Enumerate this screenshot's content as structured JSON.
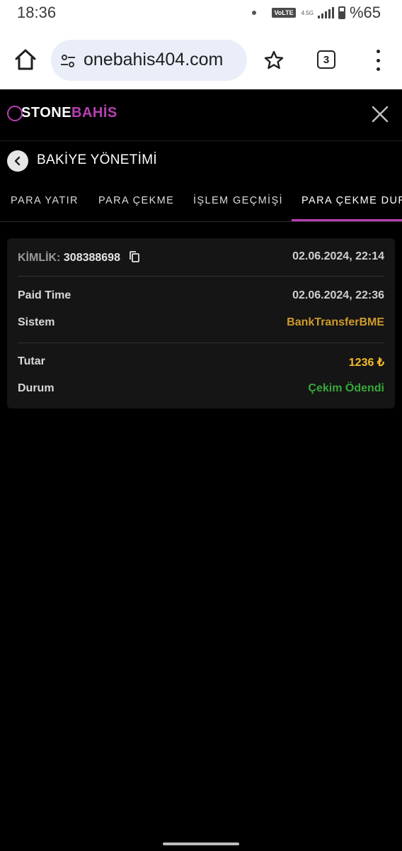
{
  "status_bar": {
    "time": "18:36",
    "volte": "VoLTE",
    "network": "4.5G",
    "battery": "%65"
  },
  "browser": {
    "url": "onebahis404.com",
    "tab_count": "3",
    "icons": [
      "home-icon",
      "site-settings-icon",
      "star-icon",
      "tab-switcher-icon",
      "overflow-menu-icon"
    ]
  },
  "app": {
    "logo_part1": "STONE",
    "logo_part2": "BAHİS",
    "brand_color": "#b83fb3"
  },
  "page": {
    "title": "BAKİYE YÖNETİMİ"
  },
  "tabs": [
    {
      "label": "PARA YATIR"
    },
    {
      "label": "PARA ÇEKME"
    },
    {
      "label": "İŞLEM GEÇMİŞİ"
    },
    {
      "label": "PARA ÇEKME DUR"
    }
  ],
  "transaction": {
    "id_label": "KİMLİK:",
    "id_value": "308388698",
    "created_at": "02.06.2024, 22:14",
    "paid_time_label": "Paid Time",
    "paid_time_value": "02.06.2024, 22:36",
    "system_label": "Sistem",
    "system_value": "BankTransferBME",
    "amount_label": "Tutar",
    "amount_value": "1236 ₺",
    "status_label": "Durum",
    "status_value": "Çekim Ödendi",
    "status_color": "#36a83a"
  }
}
